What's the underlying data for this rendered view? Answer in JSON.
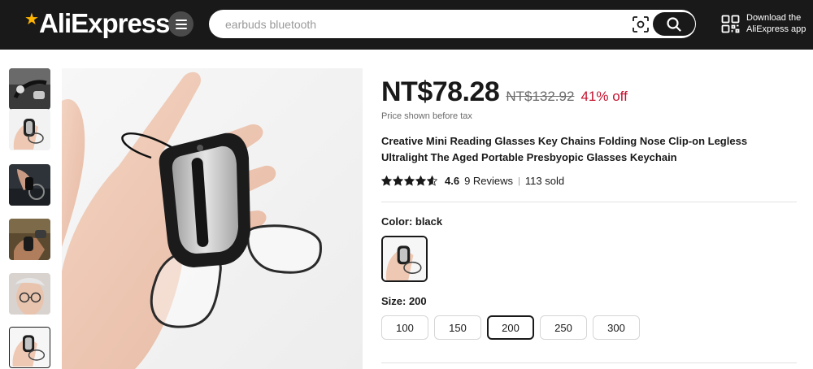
{
  "header": {
    "logo_text": "AliExpress",
    "search_placeholder": "earbuds bluetooth",
    "app_download_line1": "Download the",
    "app_download_line2": "AliExpress app",
    "icons": {
      "menu": "hamburger-menu-icon",
      "camera": "image-search-icon",
      "search": "search-icon",
      "qr": "qr-code-icon"
    }
  },
  "gallery": {
    "thumbnail_count": 6,
    "active_index": 5
  },
  "product": {
    "price": "NT$78.28",
    "original_price": "NT$132.92",
    "discount": "41% off",
    "tax_note": "Price shown before tax",
    "title": "Creative Mini Reading Glasses Key Chains Folding Nose Clip-on Legless Ultralight The Aged Portable Presbyopic Glasses Keychain",
    "rating_value": 4.6,
    "rating": "4.6",
    "reviews": "9 Reviews",
    "separator": "|",
    "sold": "113 sold"
  },
  "options": {
    "color_label": "Color: black",
    "size_label": "Size: 200",
    "sizes": [
      "100",
      "150",
      "200",
      "250",
      "300"
    ],
    "selected_size": "200"
  },
  "colors": {
    "header_bg": "#191919",
    "discount_red": "#c4122f",
    "logo_star": "#ffb400"
  }
}
